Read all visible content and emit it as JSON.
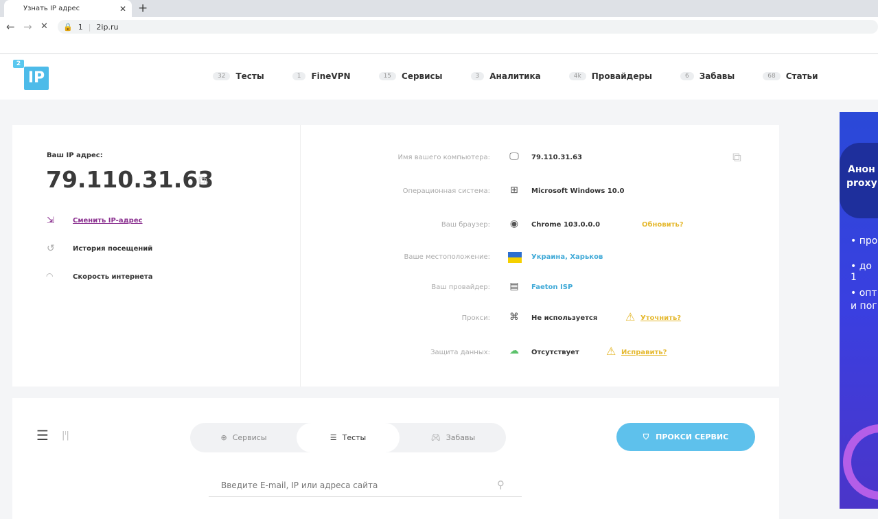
{
  "browser": {
    "tab_title": "Узнать IP адрес",
    "url_prefix": "1",
    "url": "2ip.ru"
  },
  "logo": {
    "sup": "2",
    "main": "IP"
  },
  "menu": [
    {
      "count": "32",
      "label": "Тесты"
    },
    {
      "count": "1",
      "label": "FineVPN"
    },
    {
      "count": "15",
      "label": "Сервисы"
    },
    {
      "count": "3",
      "label": "Аналитика"
    },
    {
      "count": "4k",
      "label": "Провайдеры"
    },
    {
      "count": "6",
      "label": "Забавы"
    },
    {
      "count": "68",
      "label": "Статьи"
    }
  ],
  "ip": {
    "label": "Ваш IP адрес:",
    "value": "79.110.31.63"
  },
  "links": {
    "change_ip": "Сменить IP-адрес",
    "history": "История посещений",
    "speed": "Скорость интернета"
  },
  "info": [
    {
      "label": "Имя вашего компьютера:",
      "value": "79.110.31.63"
    },
    {
      "label": "Операционная система:",
      "value": "Microsoft Windows 10.0"
    },
    {
      "label": "Ваш браузер:",
      "value": "Chrome 103.0.0.0",
      "action": "Обновить?"
    },
    {
      "label": "Ваше местоположение:",
      "value": "Украина, Харьков"
    },
    {
      "label": "Ваш провайдер:",
      "value": "Faeton ISP"
    },
    {
      "label": "Прокси:",
      "value": "Не используется",
      "action": "Уточнить?"
    },
    {
      "label": "Защита данных:",
      "value": "Отсутствует",
      "action": "Исправить?"
    }
  ],
  "tabs": {
    "services": "Сервисы",
    "tests": "Тесты",
    "fun": "Забавы"
  },
  "proxy_button": "ПРОКСИ СЕРВИС",
  "search": {
    "placeholder": "Введите E-mail, IP или адреса сайта"
  },
  "ad": {
    "title1": "Анон",
    "title2": "proxy",
    "b1": "• про",
    "b2": "• до 1",
    "b3": "• опт",
    "b4": "и пог"
  },
  "colors": {
    "accent": "#4dbbe9",
    "warning": "#e5b930",
    "link_purple": "#8a2f8f"
  }
}
